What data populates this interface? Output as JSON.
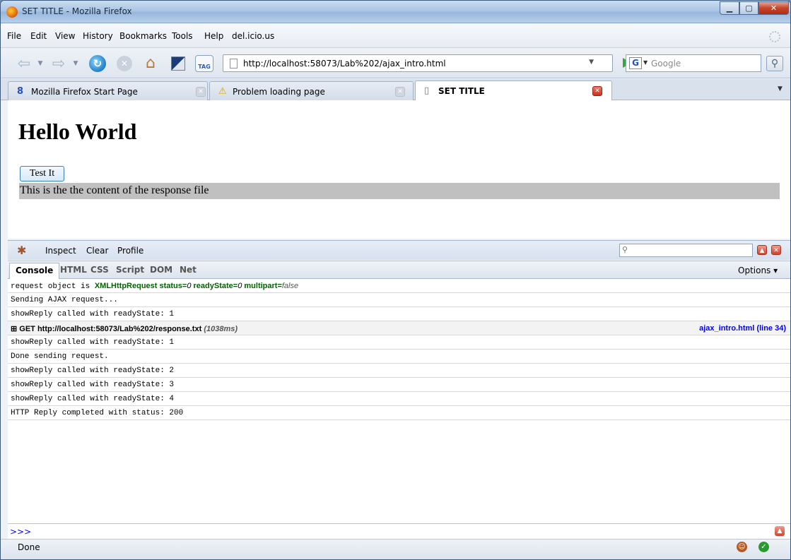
{
  "window": {
    "title": "SET TITLE - Mozilla Firefox"
  },
  "menu": [
    "File",
    "Edit",
    "View",
    "History",
    "Bookmarks",
    "Tools",
    "Help",
    "del.icio.us"
  ],
  "toolbar": {
    "url": "http://localhost:58073/Lab%202/ajax_intro.html",
    "search_placeholder": "Google",
    "tag_label": "TAG"
  },
  "tabs": [
    {
      "label": "Mozilla Firefox Start Page",
      "icon": "google-icon"
    },
    {
      "label": "Problem loading page",
      "icon": "warning-icon"
    },
    {
      "label": "SET TITLE",
      "icon": "page-icon"
    }
  ],
  "page": {
    "heading": "Hello World",
    "button_label": "Test It",
    "response_text": "This is the the content of the response file"
  },
  "firebug": {
    "menu": [
      "Inspect",
      "Clear",
      "Profile"
    ],
    "tabs": [
      "Console",
      "HTML",
      "CSS",
      "Script",
      "DOM",
      "Net"
    ],
    "options_label": "Options ▾",
    "log": [
      {
        "type": "text",
        "text": "request object is"
      },
      {
        "type": "text",
        "text": "Sending AJAX request..."
      },
      {
        "type": "text",
        "text": "showReply called with readyState: 1"
      },
      {
        "type": "request",
        "text": "GET http://localhost:58073/Lab%202/response.txt",
        "timing": "(1038ms)",
        "source": "ajax_intro.html (line 34)"
      },
      {
        "type": "text",
        "text": "showReply called with readyState: 1"
      },
      {
        "type": "text",
        "text": "Done sending request."
      },
      {
        "type": "text",
        "text": "showReply called with readyState: 2"
      },
      {
        "type": "text",
        "text": "showReply called with readyState: 3"
      },
      {
        "type": "text",
        "text": "showReply called with readyState: 4"
      },
      {
        "type": "text",
        "text": "HTTP Reply completed with status: 200"
      }
    ],
    "object": {
      "name": "XMLHttpRequest",
      "status_label": "status=",
      "status_value": "0",
      "ready_label": "readyState=",
      "ready_value": "0",
      "multipart_label": "multipart=",
      "multipart_value": "false"
    },
    "prompt": ">>>"
  },
  "status": {
    "text": "Done"
  }
}
